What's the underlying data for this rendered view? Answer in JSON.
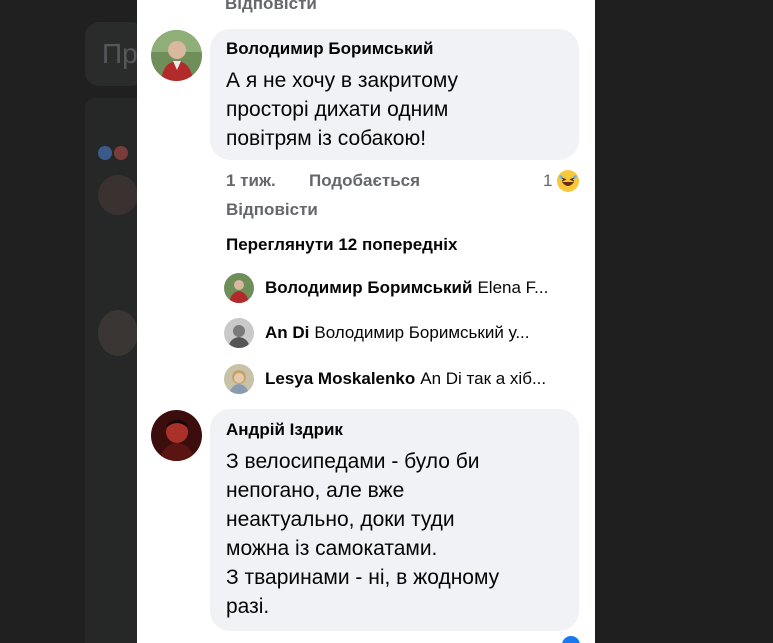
{
  "background": {
    "card_text": "Пр"
  },
  "top": {
    "reply_label": "Відповісти"
  },
  "comment1": {
    "author": "Володимир Боримський",
    "text": "А я не хочу в закритому\nпросторі дихати одним\nповітрям із собакою!",
    "time": "1 тиж.",
    "like_label": "Подобається",
    "reaction_count": "1",
    "reaction_icon": "laughing-emoji",
    "reply_label": "Відповісти",
    "view_previous": "Переглянути 12 попередніх"
  },
  "replies": [
    {
      "name": "Володимир Боримський",
      "text": "Elena F..."
    },
    {
      "name": "An Di",
      "text": "Володимир Боримський  у..."
    },
    {
      "name": "Lesya Moskalenko",
      "text": "An Di так а хіб..."
    }
  ],
  "comment2": {
    "author": "Андрій Іздрик",
    "text": "З велосипедами - було би\nнепогано, але вже\nнеактуально, доки туди\nможна із самокатами.\nЗ тваринами - ні, в жодному\nразі."
  },
  "colors": {
    "bubble": "#f0f2f5",
    "meta": "#65676b",
    "laugh": "#f7c93a"
  }
}
